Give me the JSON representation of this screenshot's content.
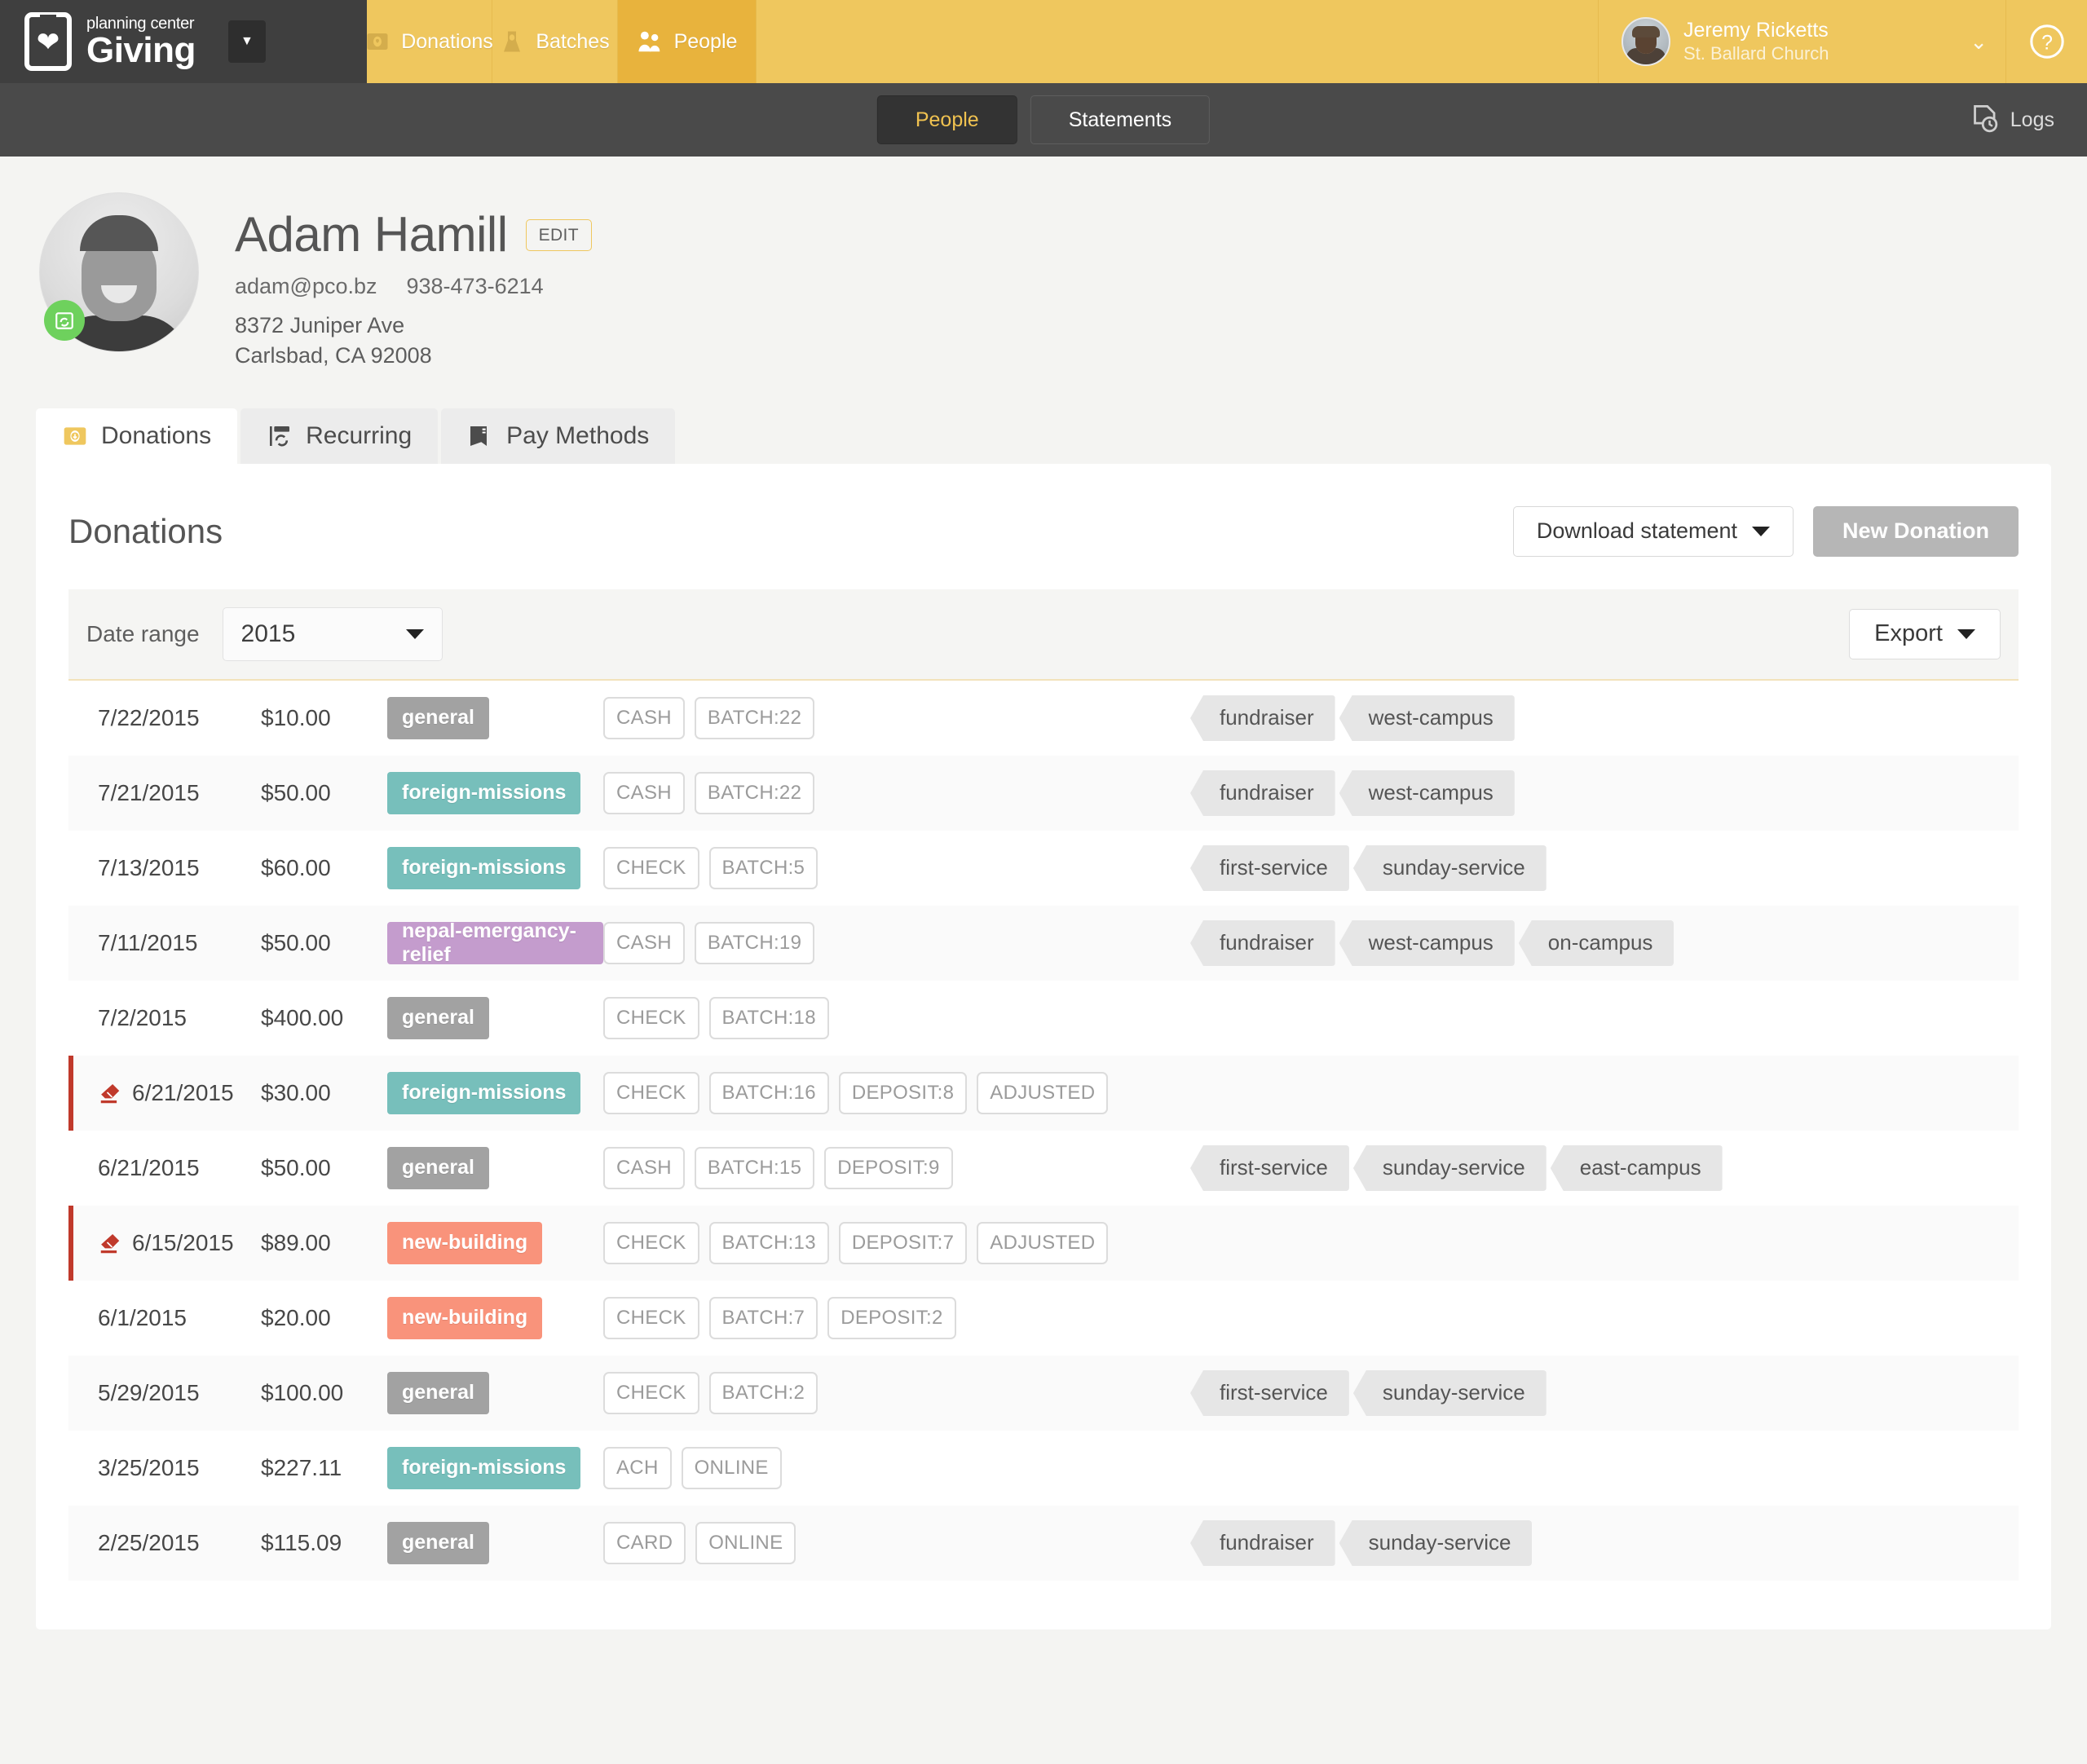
{
  "brand": {
    "sub": "planning center",
    "main": "Giving",
    "caret": "▼"
  },
  "nav": {
    "items": [
      {
        "label": "Donations",
        "icon": "donation-icon",
        "active": false
      },
      {
        "label": "Batches",
        "icon": "batch-icon",
        "active": false
      },
      {
        "label": "People",
        "icon": "people-icon",
        "active": true
      }
    ]
  },
  "user": {
    "name": "Jeremy Ricketts",
    "org": "St. Ballard Church",
    "caret": "⌄",
    "help": "?"
  },
  "subnav": {
    "people_label": "People",
    "statements_label": "Statements",
    "logs_label": "Logs"
  },
  "profile": {
    "name": "Adam Hamill",
    "edit_label": "EDIT",
    "email": "adam@pco.bz",
    "phone": "938-473-6214",
    "address_line1": "8372 Juniper Ave",
    "address_line2": "Carlsbad, CA 92008"
  },
  "tabs": [
    {
      "label": "Donations",
      "icon": "donation-icon",
      "active": true
    },
    {
      "label": "Recurring",
      "icon": "recurring-icon",
      "active": false
    },
    {
      "label": "Pay Methods",
      "icon": "pay-methods-icon",
      "active": false
    }
  ],
  "panel": {
    "title": "Donations",
    "download_statement_label": "Download statement",
    "new_donation_label": "New Donation",
    "date_range_label": "Date range",
    "date_range_value": "2015",
    "export_label": "Export"
  },
  "colors": {
    "brand_yellow": "#efc75e",
    "brand_yellow_active": "#e8b33d",
    "fund_general": "#a2a2a2",
    "fund_foreign_missions": "#77bfbb",
    "fund_nepal": "#c49ccd",
    "fund_new_building": "#f9937b",
    "flag_red": "#c0392b",
    "tag_gray": "#e6e6e6"
  },
  "donations": [
    {
      "date": "7/22/2015",
      "amount": "$10.00",
      "fund": "general",
      "fund_color": "#a2a2a2",
      "meta": [
        "CASH",
        "BATCH:22"
      ],
      "tags": [
        "fundraiser",
        "west-campus"
      ],
      "flagged": false,
      "alt": false
    },
    {
      "date": "7/21/2015",
      "amount": "$50.00",
      "fund": "foreign-missions",
      "fund_color": "#77bfbb",
      "meta": [
        "CASH",
        "BATCH:22"
      ],
      "tags": [
        "fundraiser",
        "west-campus"
      ],
      "flagged": false,
      "alt": true
    },
    {
      "date": "7/13/2015",
      "amount": "$60.00",
      "fund": "foreign-missions",
      "fund_color": "#77bfbb",
      "meta": [
        "CHECK",
        "BATCH:5"
      ],
      "tags": [
        "first-service",
        "sunday-service"
      ],
      "flagged": false,
      "alt": false
    },
    {
      "date": "7/11/2015",
      "amount": "$50.00",
      "fund": "nepal-emergancy-relief",
      "fund_color": "#c49ccd",
      "meta": [
        "CASH",
        "BATCH:19"
      ],
      "tags": [
        "fundraiser",
        "west-campus",
        "on-campus"
      ],
      "flagged": false,
      "alt": true
    },
    {
      "date": "7/2/2015",
      "amount": "$400.00",
      "fund": "general",
      "fund_color": "#a2a2a2",
      "meta": [
        "CHECK",
        "BATCH:18"
      ],
      "tags": [],
      "flagged": false,
      "alt": false
    },
    {
      "date": "6/21/2015",
      "amount": "$30.00",
      "fund": "foreign-missions",
      "fund_color": "#77bfbb",
      "meta": [
        "CHECK",
        "BATCH:16",
        "DEPOSIT:8",
        "ADJUSTED"
      ],
      "tags": [],
      "flagged": true,
      "alt": true
    },
    {
      "date": "6/21/2015",
      "amount": "$50.00",
      "fund": "general",
      "fund_color": "#a2a2a2",
      "meta": [
        "CASH",
        "BATCH:15",
        "DEPOSIT:9"
      ],
      "tags": [
        "first-service",
        "sunday-service",
        "east-campus"
      ],
      "flagged": false,
      "alt": false
    },
    {
      "date": "6/15/2015",
      "amount": "$89.00",
      "fund": "new-building",
      "fund_color": "#f9937b",
      "meta": [
        "CHECK",
        "BATCH:13",
        "DEPOSIT:7",
        "ADJUSTED"
      ],
      "tags": [],
      "flagged": true,
      "alt": true
    },
    {
      "date": "6/1/2015",
      "amount": "$20.00",
      "fund": "new-building",
      "fund_color": "#f9937b",
      "meta": [
        "CHECK",
        "BATCH:7",
        "DEPOSIT:2"
      ],
      "tags": [],
      "flagged": false,
      "alt": false
    },
    {
      "date": "5/29/2015",
      "amount": "$100.00",
      "fund": "general",
      "fund_color": "#a2a2a2",
      "meta": [
        "CHECK",
        "BATCH:2"
      ],
      "tags": [
        "first-service",
        "sunday-service"
      ],
      "flagged": false,
      "alt": true
    },
    {
      "date": "3/25/2015",
      "amount": "$227.11",
      "fund": "foreign-missions",
      "fund_color": "#77bfbb",
      "meta": [
        "ACH",
        "ONLINE"
      ],
      "tags": [],
      "flagged": false,
      "alt": false
    },
    {
      "date": "2/25/2015",
      "amount": "$115.09",
      "fund": "general",
      "fund_color": "#a2a2a2",
      "meta": [
        "CARD",
        "ONLINE"
      ],
      "tags": [
        "fundraiser",
        "sunday-service"
      ],
      "flagged": false,
      "alt": true
    }
  ]
}
